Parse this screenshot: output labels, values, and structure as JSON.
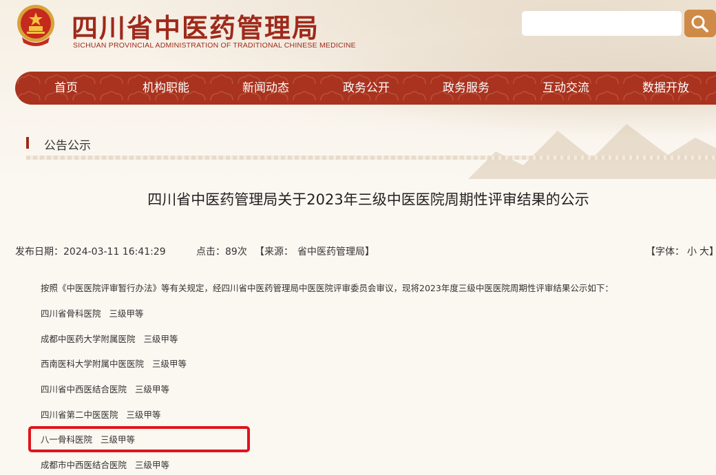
{
  "header": {
    "title": "四川省中医药管理局",
    "subtitle": "SICHUAN PROVINCIAL ADMINISTRATION OF TRADITIONAL CHINESE MEDICINE",
    "emblem_icon": "national-emblem-icon",
    "search_placeholder": "",
    "search_icon": "magnifier-icon"
  },
  "nav": {
    "items": [
      {
        "label": "首页"
      },
      {
        "label": "机构职能"
      },
      {
        "label": "新闻动态"
      },
      {
        "label": "政务公开"
      },
      {
        "label": "政务服务"
      },
      {
        "label": "互动交流"
      },
      {
        "label": "数据开放"
      }
    ]
  },
  "section": {
    "title": "公告公示"
  },
  "article": {
    "title": "四川省中医药管理局关于2023年三级中医医院周期性评审结果的公示",
    "meta": {
      "date_label": "发布日期：",
      "date_value": "2024-03-11 16:41:29",
      "clicks_label": "点击：",
      "clicks_value": "89",
      "clicks_unit": "次",
      "source_prefix": "【来源：",
      "source_value": "省中医药管理局",
      "source_suffix": "】",
      "font_prefix": "【字体：",
      "font_small": "小",
      "font_large": "大",
      "font_suffix": "】"
    },
    "intro": "按照《中医医院评审暂行办法》等有关规定，经四川省中医药管理局中医医院评审委员会审议，现将2023年度三级中医医院周期性评审结果公示如下：",
    "hospitals": [
      {
        "name": "四川省骨科医院",
        "grade": "三级甲等"
      },
      {
        "name": "成都中医药大学附属医院",
        "grade": "三级甲等"
      },
      {
        "name": "西南医科大学附属中医医院",
        "grade": "三级甲等"
      },
      {
        "name": "四川省中西医结合医院",
        "grade": "三级甲等"
      },
      {
        "name": "四川省第二中医医院",
        "grade": "三级甲等"
      },
      {
        "name": "八一骨科医院",
        "grade": "三级甲等"
      },
      {
        "name": "成都市中西医结合医院",
        "grade": "三级甲等"
      }
    ]
  },
  "colors": {
    "brand_red": "#9e2a1b",
    "nav_bg": "#a9331f",
    "search_button": "#d08a47",
    "highlight": "#e0141b"
  }
}
